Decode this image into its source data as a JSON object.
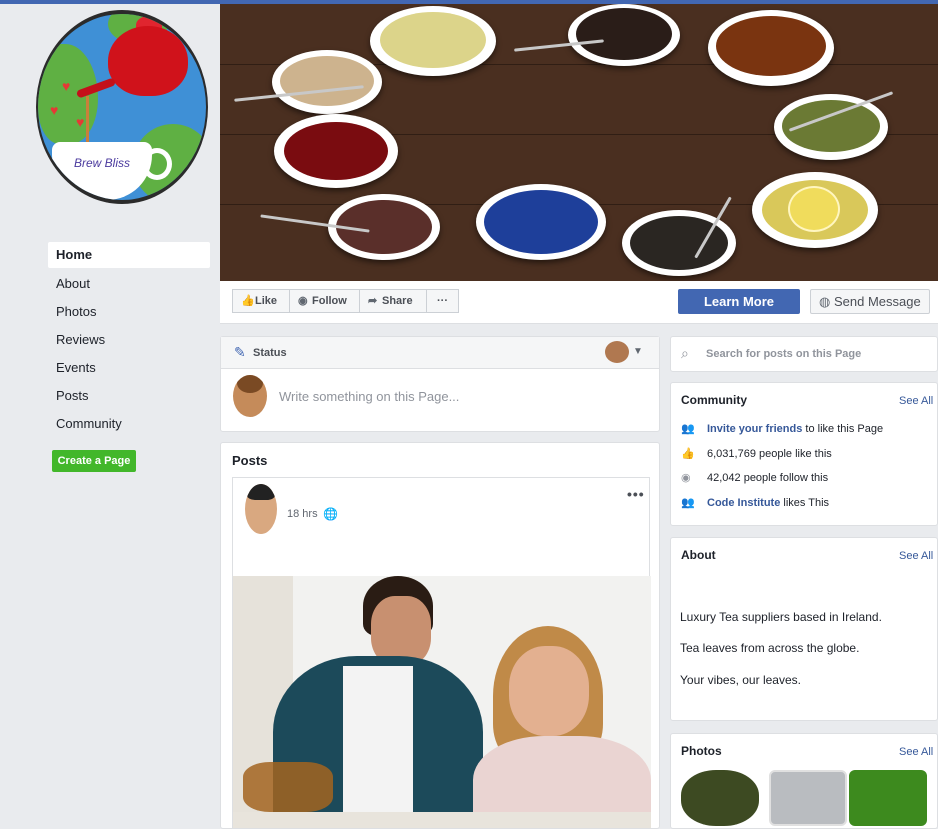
{
  "page": {
    "brand_name": "Brew Bliss"
  },
  "sidebar": {
    "items": [
      {
        "label": "Home"
      },
      {
        "label": "About"
      },
      {
        "label": "Photos"
      },
      {
        "label": "Reviews"
      },
      {
        "label": "Events"
      },
      {
        "label": "Posts"
      },
      {
        "label": "Community"
      }
    ],
    "create_label": "Create a Page"
  },
  "actions": {
    "like": "Like",
    "follow": "Follow",
    "share": "Share",
    "more": "···",
    "learn_more": "Learn More",
    "send_message": "Send Message"
  },
  "status": {
    "label": "Status",
    "placeholder": "Write something on this Page..."
  },
  "posts": {
    "title": "Posts",
    "time": "18 hrs",
    "menu": "•••"
  },
  "search": {
    "placeholder": "Search for posts on this Page"
  },
  "community": {
    "title": "Community",
    "see_all": "See All",
    "invite_link": "Invite your friends",
    "invite_rest": " to like this Page",
    "likes": "6,031,769 people like this",
    "follows": "42,042 people follow this",
    "ci_link": "Code Institute",
    "ci_rest": " likes This"
  },
  "about": {
    "title": "About",
    "see_all": "See All",
    "lines": [
      "Luxury Tea suppliers based in Ireland.",
      "Tea leaves from across the globe.",
      "Your vibes, our leaves."
    ]
  },
  "photos": {
    "title": "Photos",
    "see_all": "See All"
  },
  "colors": {
    "brand_blue": "#4267b2",
    "create_green": "#42b72a",
    "link_blue": "#365899"
  }
}
